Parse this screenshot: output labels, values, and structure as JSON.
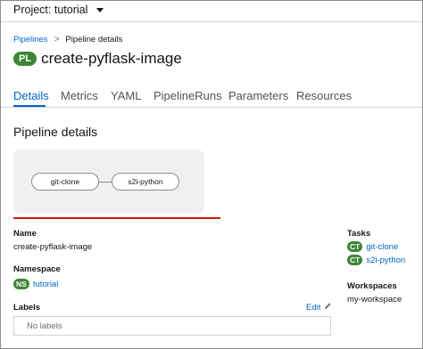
{
  "project_bar": {
    "label": "Project: tutorial"
  },
  "breadcrumb": {
    "parent": "Pipelines",
    "separator": ">",
    "current": "Pipeline details"
  },
  "header": {
    "badge": "PL",
    "title": "create-pyflask-image"
  },
  "tabs": [
    {
      "label": "Details",
      "active": true
    },
    {
      "label": "Metrics"
    },
    {
      "label": "YAML"
    },
    {
      "label": "PipelineRuns"
    },
    {
      "label": "Parameters"
    },
    {
      "label": "Resources"
    }
  ],
  "section_title": "Pipeline details",
  "graph": {
    "nodes": [
      "git-clone",
      "s2i-python"
    ]
  },
  "details": {
    "name_label": "Name",
    "name_value": "create-pyflask-image",
    "namespace_label": "Namespace",
    "namespace_badge": "NS",
    "namespace_value": "tutorial",
    "labels_label": "Labels",
    "edit_label": "Edit",
    "labels_empty": "No labels"
  },
  "side": {
    "tasks_label": "Tasks",
    "tasks": [
      {
        "badge": "CT",
        "name": "git-clone"
      },
      {
        "badge": "CT",
        "name": "s2i-python"
      }
    ],
    "workspaces_label": "Workspaces",
    "workspace_value": "my-workspace"
  },
  "colors": {
    "accent": "#0066cc",
    "badge_green": "#3e8635",
    "highlight_red": "#c9190b"
  },
  "icons": {
    "caret": "caret-down-icon",
    "edit": "pencil-icon"
  }
}
